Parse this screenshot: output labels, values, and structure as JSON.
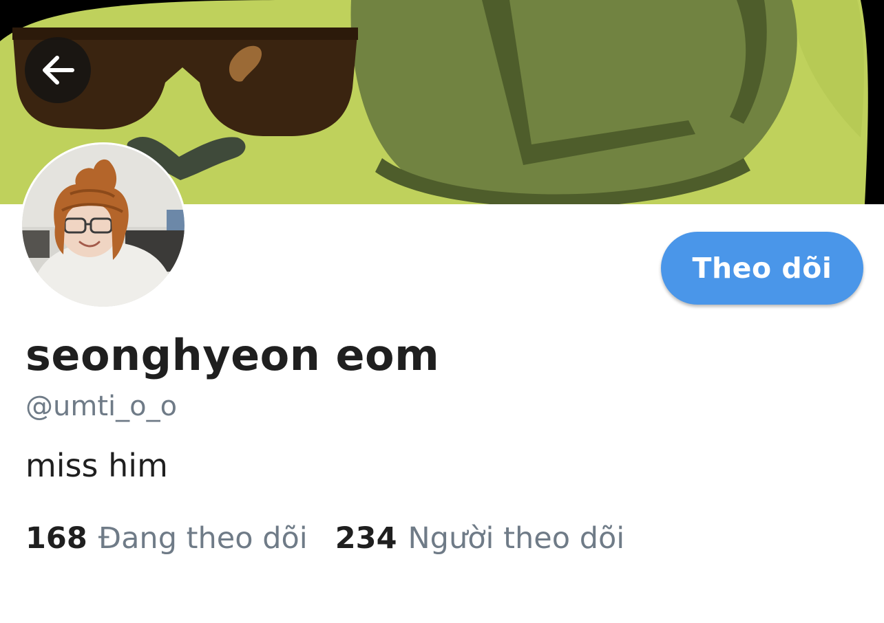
{
  "profile": {
    "display_name": "seonghyeon eom",
    "handle": "@umti_o_o",
    "bio": "miss him"
  },
  "actions": {
    "follow_label": "Theo dõi",
    "back_icon": "arrow-left-icon"
  },
  "stats": {
    "following_count": "168",
    "following_label": "Đang theo dõi",
    "followers_count": "234",
    "followers_label": "Người theo dõi"
  },
  "colors": {
    "accent": "#4a96e9",
    "text_primary": "#1f1f1f",
    "text_secondary": "#6f7b87",
    "banner_background": "#000000",
    "banner_green": "#bfd15c",
    "banner_shell": "#718341"
  }
}
